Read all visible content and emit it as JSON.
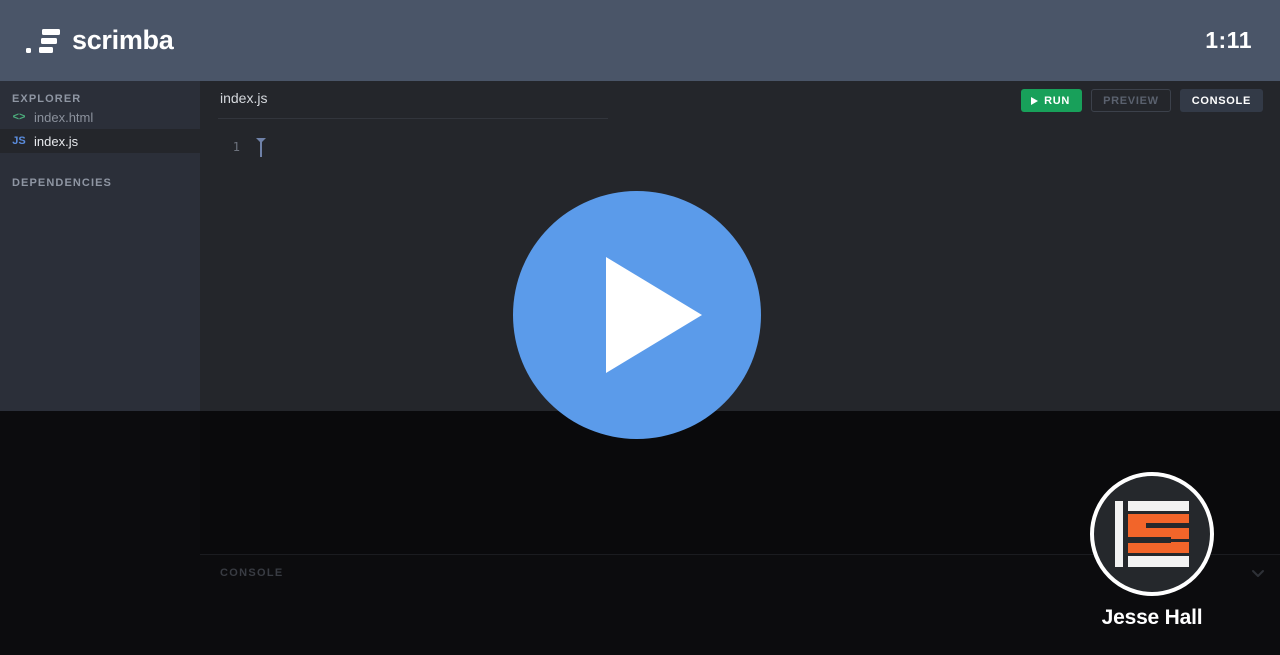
{
  "header": {
    "brand_name": "scrimba",
    "brand_icon": "scrimba-logo-icon",
    "timer": "1:11"
  },
  "sidebar": {
    "explorer_title": "EXPLORER",
    "dependencies_title": "DEPENDENCIES",
    "files": [
      {
        "name": "index.html",
        "icon": "html-file-icon",
        "icon_glyph": "<>",
        "active": false
      },
      {
        "name": "index.js",
        "icon": "js-file-icon",
        "icon_glyph": "JS",
        "active": true
      }
    ]
  },
  "editor": {
    "tab_label": "index.js",
    "line_numbers": [
      "1"
    ],
    "lines": [
      ""
    ],
    "cursor_visible": true
  },
  "toolbar": {
    "run_label": "RUN",
    "run_icon": "play-icon",
    "preview_label": "PREVIEW",
    "console_label": "CONSOLE"
  },
  "console": {
    "label": "CONSOLE",
    "collapse_icon": "chevron-down-icon",
    "output": []
  },
  "player": {
    "play_icon": "play-icon",
    "play_button_label": "Play"
  },
  "author": {
    "name": "Jesse Hall",
    "avatar_icon": "mongodb-avatar-logo-icon"
  },
  "colors": {
    "header_bg": "#4a5568",
    "sidebar_bg": "#2b2f39",
    "editor_bg": "#24262b",
    "overlay_bg": "#0a0a0c",
    "run_green": "#18a05a",
    "play_blue": "#5b9bea",
    "avatar_orange": "#f2652a",
    "js_icon_blue": "#5b8dde",
    "html_icon_green": "#4caf7d"
  }
}
